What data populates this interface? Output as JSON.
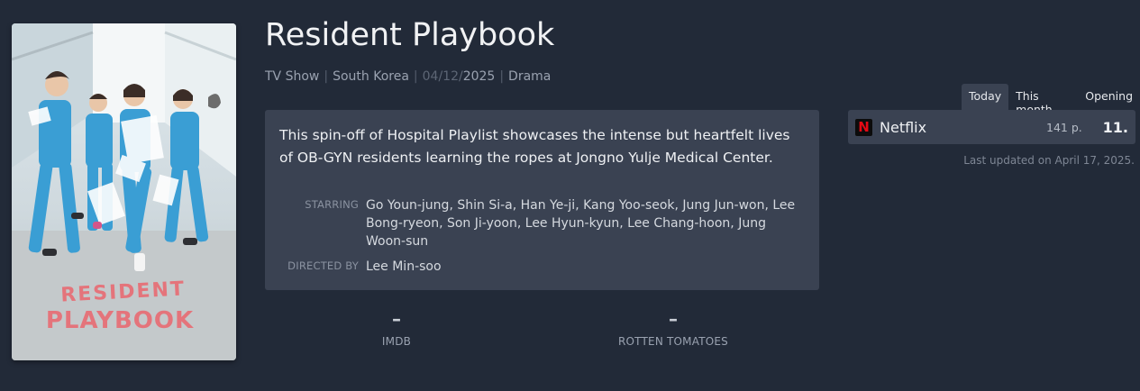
{
  "poster": {
    "title_line1": "RESIDENT",
    "title_line2": "PLAYBOOK"
  },
  "show": {
    "title": "Resident Playbook",
    "type": "TV Show",
    "country": "South Korea",
    "date_dim": "04/12/",
    "date_year": "2025",
    "genre": "Drama",
    "synopsis": "This spin-off of Hospital Playlist showcases the intense but heartfelt lives of OB-GYN residents learning the ropes at Jongno Yulje Medical Center.",
    "starring_label": "STARRING",
    "starring": "Go Youn-jung, Shin Si-a, Han Ye-ji, Kang Yoo-seok, Jung Jun-won, Lee Bong-ryeon, Son Ji-yoon, Lee Hyun-kyun, Lee Chang-hoon, Jung Woon-sun",
    "directed_label": "DIRECTED BY",
    "director": "Lee Min-soo"
  },
  "ratings": [
    {
      "value": "–",
      "label": "IMDB"
    },
    {
      "value": "–",
      "label": "ROTTEN TOMATOES"
    }
  ],
  "ranking": {
    "tabs": [
      "Today",
      "This month",
      "Opening"
    ],
    "active_tab": "Today",
    "platform_icon": "N",
    "platform_icon_name": "netflix-logo-icon",
    "platform_color": "#e50914",
    "platform": "Netflix",
    "points": "141 p.",
    "position": "11.",
    "updated": "Last updated on April 17, 2025."
  }
}
